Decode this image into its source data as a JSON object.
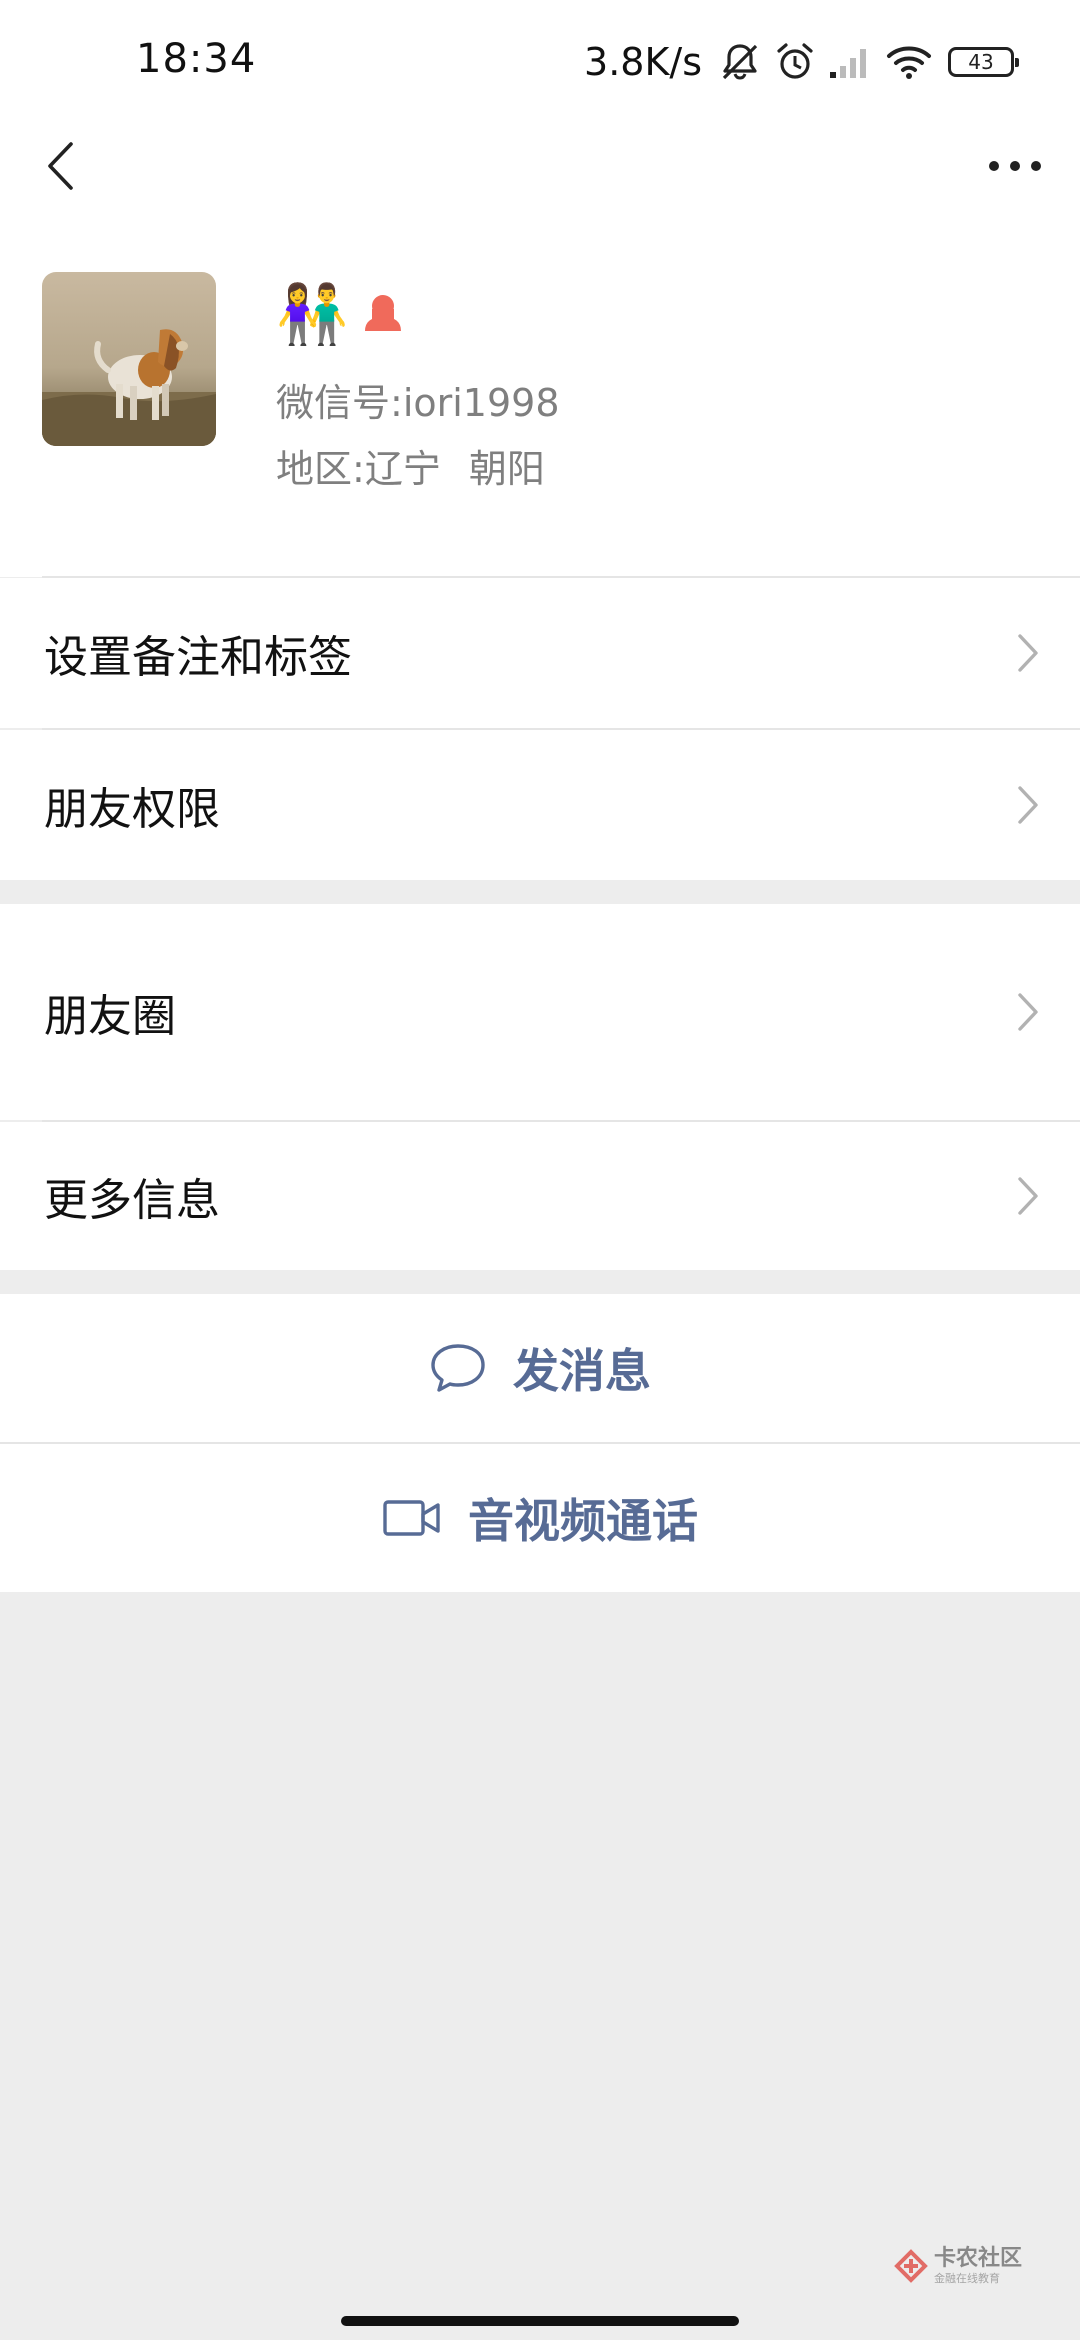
{
  "status_bar": {
    "time": "18:34",
    "net_speed": "3.8K/s",
    "battery": "43",
    "icons": [
      "notifications-muted-icon",
      "alarm-icon",
      "signal-icon",
      "wifi-icon",
      "battery-icon"
    ]
  },
  "nav": {
    "back_icon": "back-chevron-icon",
    "more_icon": "more-dots-icon"
  },
  "profile": {
    "nickname_emoji": "👫",
    "gender_icon": "female-icon",
    "wechat_id_label": "微信号:",
    "wechat_id_value": "iori1998",
    "region_label": "地区:",
    "region_province": "辽宁",
    "region_city": "朝阳"
  },
  "cells": {
    "remark_tags": "设置备注和标签",
    "friend_permissions": "朋友权限",
    "moments": "朋友圈",
    "more_info": "更多信息"
  },
  "actions": {
    "send_message": "发消息",
    "av_call": "音视频通话"
  },
  "watermark": {
    "main": "卡农社区",
    "sub": "金融在线教育"
  },
  "colors": {
    "link_blue": "#576b95",
    "background": "#ededed",
    "female_icon": "#f06a5b"
  }
}
